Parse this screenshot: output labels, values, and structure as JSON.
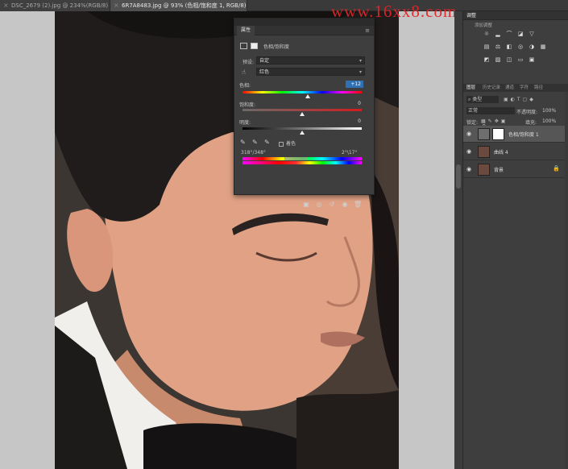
{
  "tabs": [
    {
      "label": "DSC_2679 (2).jpg @ 234%(RGB/8)"
    },
    {
      "label": "6R7A8483.jpg @ 93% (色相/饱和度 1, RGB/8) *"
    }
  ],
  "watermark": "www.16xx8.com",
  "properties": {
    "panel_tab": "属性",
    "menu_icon": "menu-icon",
    "adjustment_title": "色相/饱和度",
    "preset_label": "预设:",
    "preset_value": "自定",
    "channel_value": "红色",
    "hue_label": "色相:",
    "hue_value": "+12",
    "saturation_label": "饱和度:",
    "saturation_value": "0",
    "lightness_label": "明度:",
    "lightness_value": "0",
    "colorize_label": "着色",
    "range_left": "318°/348°",
    "range_right": "2°\\17°",
    "hue_level": 0.55,
    "saturation_level": 0.5,
    "lightness_level": 0.5
  },
  "dock": {
    "adjustments_header": "调整",
    "adjustments_sub": "添加调整",
    "layers_tabs": [
      "图层",
      "历史记录",
      "通道",
      "字符",
      "路径"
    ],
    "filter_label": "类型",
    "blend_mode": "正常",
    "opacity_label": "不透明度:",
    "opacity_value": "100%",
    "lock_label": "锁定:",
    "fill_label": "填充:",
    "fill_value": "100%",
    "layers": [
      {
        "name": "色相/饱和度 1",
        "selected": true
      },
      {
        "name": "曲线 4",
        "selected": false
      },
      {
        "name": "背景",
        "selected": false
      }
    ]
  },
  "colors": {
    "accent": "#2f6fb3",
    "panel_bg": "#3e3e3e",
    "app_bg": "#535353",
    "watermark": "#e0262b"
  }
}
